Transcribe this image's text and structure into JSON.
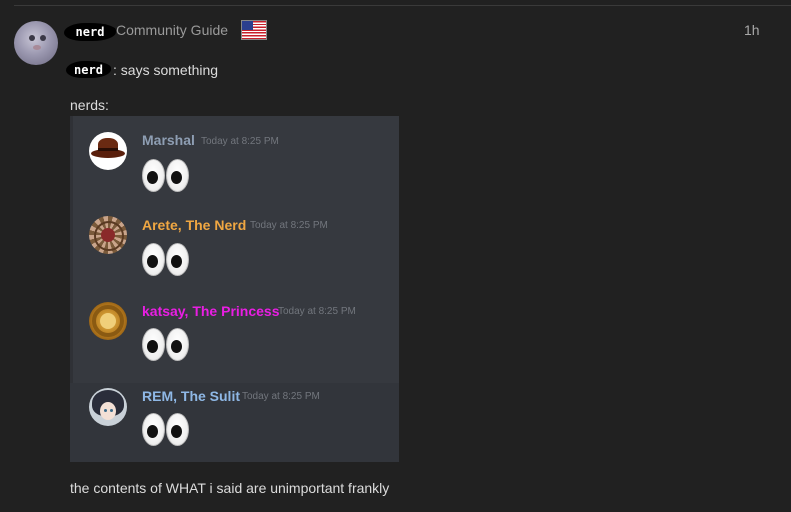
{
  "post": {
    "author_nick": "nerd",
    "author_role": "Community Guide",
    "flag_icon": "us-flag-icon",
    "time": "1h",
    "line1_nick": "nerd",
    "line1_text": ": says something",
    "line2_text": "nerds:",
    "footer_text": "the contents of WHAT i said are unimportant frankly"
  },
  "embed": {
    "messages": [
      {
        "username": "Marshal",
        "timestamp": "Today at 8:25 PM",
        "color": "#8e9eb3",
        "content": "eyes-emoji"
      },
      {
        "username": "Arete, The Nerd",
        "timestamp": "Today at 8:25 PM",
        "color": "#f0a742",
        "content": "eyes-emoji"
      },
      {
        "username": "katsay, The Princess",
        "timestamp": "Today at 8:25 PM",
        "color": "#e91ee3",
        "content": "eyes-emoji"
      },
      {
        "username": "REM, The Sulit",
        "timestamp": "Today at 8:25 PM",
        "color": "#8fb8e6",
        "content": "eyes-emoji"
      }
    ]
  }
}
